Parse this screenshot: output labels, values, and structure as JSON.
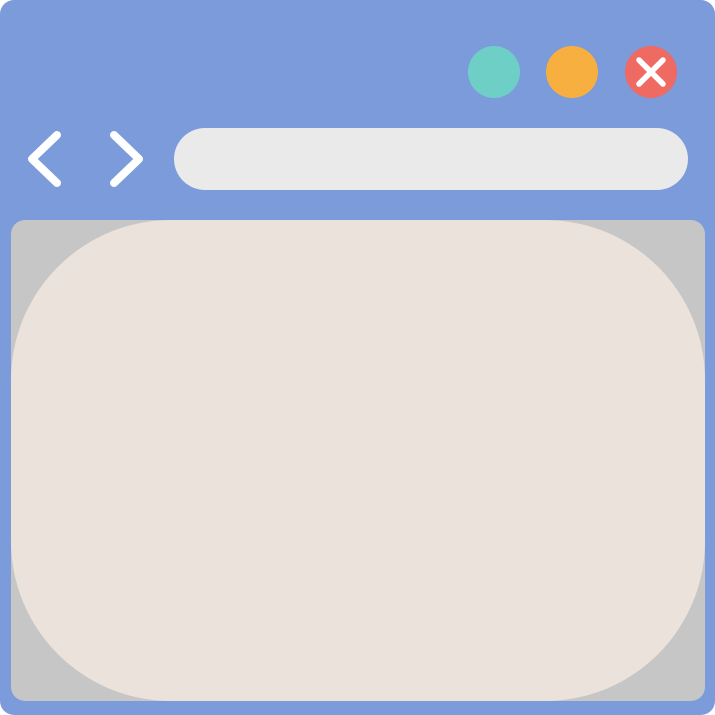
{
  "window": {
    "controls": [
      {
        "name": "minimize",
        "color": "#6ecfc7"
      },
      {
        "name": "maximize",
        "color": "#f7b03f"
      },
      {
        "name": "close",
        "color": "#ee6a63",
        "icon": "close-icon"
      }
    ],
    "navigation": {
      "back_icon": "chevron-left-icon",
      "forward_icon": "chevron-right-icon"
    },
    "address_bar": {
      "value": "",
      "placeholder": ""
    }
  },
  "colors": {
    "frame": "#7b9bdb",
    "address_bar": "#eaeaea",
    "content_background": "#c6c6c6",
    "page": "#ebe2db",
    "icon": "#ffffff"
  }
}
